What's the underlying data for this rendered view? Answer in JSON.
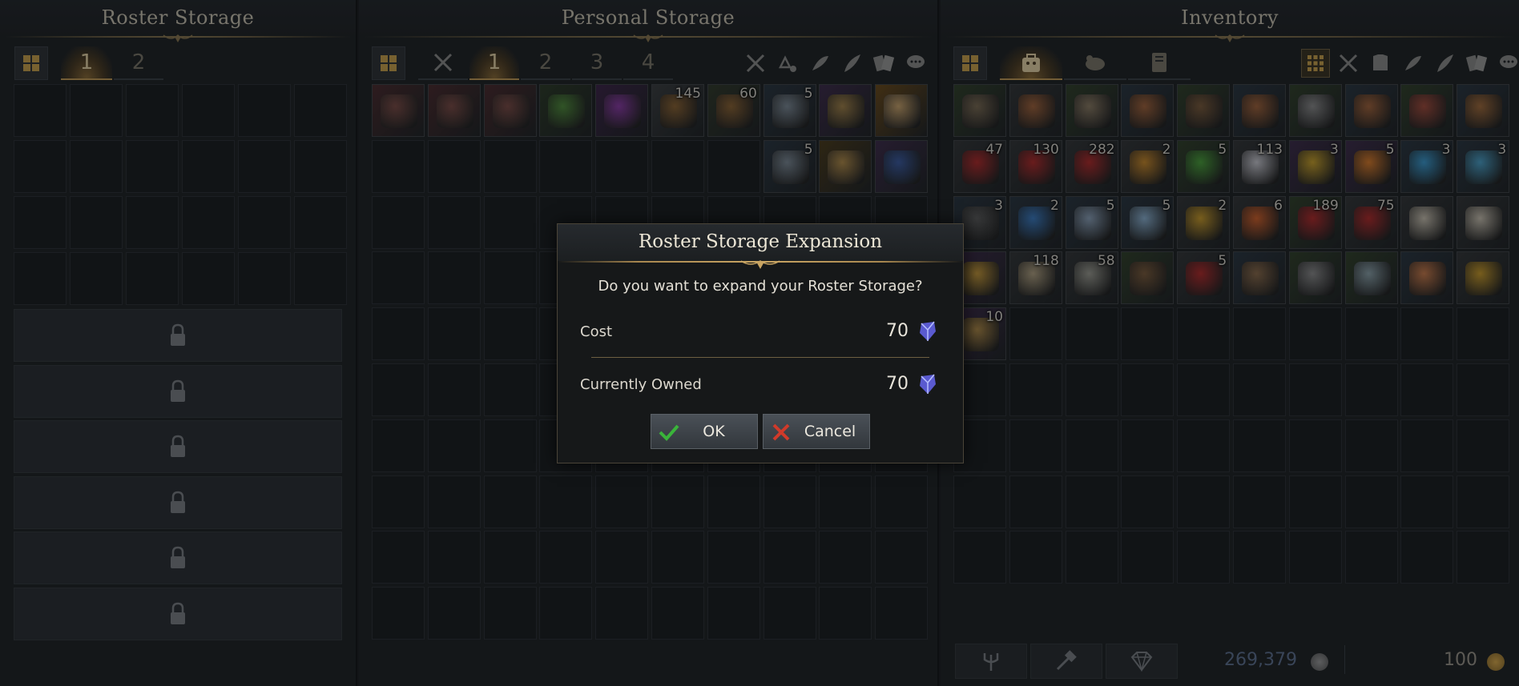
{
  "roster_storage": {
    "title": "Roster Storage",
    "tabs": [
      "1",
      "2"
    ],
    "active_tab": "1",
    "locked_rows": 6
  },
  "personal_storage": {
    "title": "Personal Storage",
    "tabs": [
      "1",
      "2",
      "3",
      "4"
    ],
    "active_tab": "1",
    "filter_icons": [
      "crossed-swords-icon",
      "recycle-icon",
      "herb-icon",
      "feather-icon",
      "cards-icon",
      "chat-icon"
    ],
    "items": [
      {
        "name": "red-chest",
        "count": "",
        "bg": "#4a2a2c",
        "art": "#7a4a44"
      },
      {
        "name": "red-chest",
        "count": "",
        "bg": "#4a2a2c",
        "art": "#7a4a44"
      },
      {
        "name": "red-chest",
        "count": "",
        "bg": "#4a2a2c",
        "art": "#7a4a44"
      },
      {
        "name": "green-chest",
        "count": "",
        "bg": "#2c3a26",
        "art": "#4f8a3a"
      },
      {
        "name": "purple-chest",
        "count": "",
        "bg": "#3c2348",
        "art": "#8a3aa5"
      },
      {
        "name": "seed",
        "count": "145",
        "bg": "#3a3d3f",
        "art": "#8a6232"
      },
      {
        "name": "seed",
        "count": "60",
        "bg": "#31392a",
        "art": "#8a6232"
      },
      {
        "name": "blue-ore-chest",
        "count": "5",
        "bg": "#2a3540",
        "art": "#7b8894"
      },
      {
        "name": "gold-ore-chest",
        "count": "",
        "bg": "#3d2b4a",
        "art": "#a08048"
      },
      {
        "name": "wing",
        "count": "",
        "bg": "#6a4a1a",
        "art": "#c8a26a"
      },
      {
        "name": "blue-ore-chest",
        "count": "5",
        "bg": "#2a3540",
        "art": "#7b8894",
        "slot": 17
      },
      {
        "name": "gold-box",
        "count": "",
        "bg": "#4a3a1a",
        "art": "#b08a48",
        "slot": 18
      },
      {
        "name": "blue-chest",
        "count": "",
        "bg": "#3d2b4a",
        "art": "#3a5aa0",
        "slot": 19
      }
    ]
  },
  "inventory": {
    "title": "Inventory",
    "filter_icons": [
      "crossed-swords-icon",
      "armor-icon",
      "herb-icon",
      "feather-icon",
      "cards-icon",
      "chat-icon"
    ],
    "items": [
      {
        "name": "gloves",
        "count": "",
        "bg": "#31402a",
        "art": "#7a6a52"
      },
      {
        "name": "gloves",
        "count": "",
        "bg": "#333537",
        "art": "#a0623a"
      },
      {
        "name": "axe",
        "count": "",
        "bg": "#31402a",
        "art": "#8a7a62"
      },
      {
        "name": "axe",
        "count": "",
        "bg": "#2a3540",
        "art": "#a0623a"
      },
      {
        "name": "pickaxe",
        "count": "",
        "bg": "#31402a",
        "art": "#7a5a3a"
      },
      {
        "name": "pickaxe",
        "count": "",
        "bg": "#2a3540",
        "art": "#a0623a"
      },
      {
        "name": "blade",
        "count": "",
        "bg": "#31402a",
        "art": "#8a8a8a"
      },
      {
        "name": "blade",
        "count": "",
        "bg": "#2a3540",
        "art": "#a0623a"
      },
      {
        "name": "fishing-rod",
        "count": "",
        "bg": "#31402a",
        "art": "#a04a3a"
      },
      {
        "name": "fishing-rod",
        "count": "",
        "bg": "#2a3540",
        "art": "#a06a3a"
      },
      {
        "name": "red-potion",
        "count": "47",
        "bg": "#333537",
        "art": "#b02a2a"
      },
      {
        "name": "red-potion",
        "count": "130",
        "bg": "#333537",
        "art": "#b02a2a"
      },
      {
        "name": "red-potion",
        "count": "282",
        "bg": "#333537",
        "art": "#b02a2a"
      },
      {
        "name": "ale",
        "count": "2",
        "bg": "#333537",
        "art": "#c8882a"
      },
      {
        "name": "green-potion",
        "count": "5",
        "bg": "#31402a",
        "art": "#4aa03a"
      },
      {
        "name": "feather",
        "count": "113",
        "bg": "#333537",
        "art": "#c8c8d0"
      },
      {
        "name": "yellow-flask",
        "count": "3",
        "bg": "#3d2b4a",
        "art": "#c8a02a"
      },
      {
        "name": "orange-flask",
        "count": "5",
        "bg": "#3d2b4a",
        "art": "#d87a2a"
      },
      {
        "name": "blue-flask",
        "count": "3",
        "bg": "#2a3540",
        "art": "#3a9ad0"
      },
      {
        "name": "blue-flask",
        "count": "3",
        "bg": "#2a3540",
        "art": "#4aa0c8"
      },
      {
        "name": "bomb",
        "count": "3",
        "bg": "#2a3540",
        "art": "#5a5a5a"
      },
      {
        "name": "cocktail",
        "count": "2",
        "bg": "#2a3540",
        "art": "#3a7ac0"
      },
      {
        "name": "crystal",
        "count": "5",
        "bg": "#2a3540",
        "art": "#8aa0b8"
      },
      {
        "name": "crystal-shard",
        "count": "5",
        "bg": "#2a3540",
        "art": "#8ab0d0"
      },
      {
        "name": "gold-flask",
        "count": "2",
        "bg": "#333537",
        "art": "#c89a2a"
      },
      {
        "name": "campfire",
        "count": "6",
        "bg": "#333537",
        "art": "#d0602a"
      },
      {
        "name": "red-potion",
        "count": "189",
        "bg": "#31402a",
        "art": "#b02a2a"
      },
      {
        "name": "red-potion",
        "count": "75",
        "bg": "#333537",
        "art": "#b02a2a"
      },
      {
        "name": "scroll",
        "count": "",
        "bg": "#333537",
        "art": "#c8c0b0"
      },
      {
        "name": "scroll",
        "count": "",
        "bg": "#333537",
        "art": "#c8c0b0"
      },
      {
        "name": "mace",
        "count": "",
        "bg": "#3d2b4a",
        "art": "#c89a3a"
      },
      {
        "name": "ore-pile",
        "count": "118",
        "bg": "#333537",
        "art": "#b0a080"
      },
      {
        "name": "ore-pile",
        "count": "58",
        "bg": "#333537",
        "art": "#9a9a90"
      },
      {
        "name": "wood-chest",
        "count": "",
        "bg": "#31402a",
        "art": "#7a5a3a"
      },
      {
        "name": "red-potion",
        "count": "5",
        "bg": "#333537",
        "art": "#b02a2a"
      },
      {
        "name": "belt",
        "count": "",
        "bg": "#2a3540",
        "art": "#8a6a4a"
      },
      {
        "name": "shovel",
        "count": "",
        "bg": "#31402a",
        "art": "#8a8a8a"
      },
      {
        "name": "statue",
        "count": "",
        "bg": "#31402a",
        "art": "#8aa0a8"
      },
      {
        "name": "shovel",
        "count": "",
        "bg": "#2a3540",
        "art": "#c87a4a"
      },
      {
        "name": "gold-flask",
        "count": "",
        "bg": "#333537",
        "art": "#c89a2a"
      },
      {
        "name": "gold-box",
        "count": "10",
        "bg": "#3d2b4a",
        "art": "#b08a48"
      }
    ],
    "silver": "269,379",
    "gold": "100"
  },
  "dialog": {
    "title": "Roster Storage Expansion",
    "question": "Do you want to expand your Roster Storage?",
    "cost_label": "Cost",
    "cost_value": "70",
    "owned_label": "Currently Owned",
    "owned_value": "70",
    "ok_label": "OK",
    "cancel_label": "Cancel"
  },
  "colors": {
    "accent_gold": "#c9a563",
    "ok_green": "#3ab43a",
    "cancel_red": "#d03a2a",
    "silver_text": "#5e7090"
  }
}
